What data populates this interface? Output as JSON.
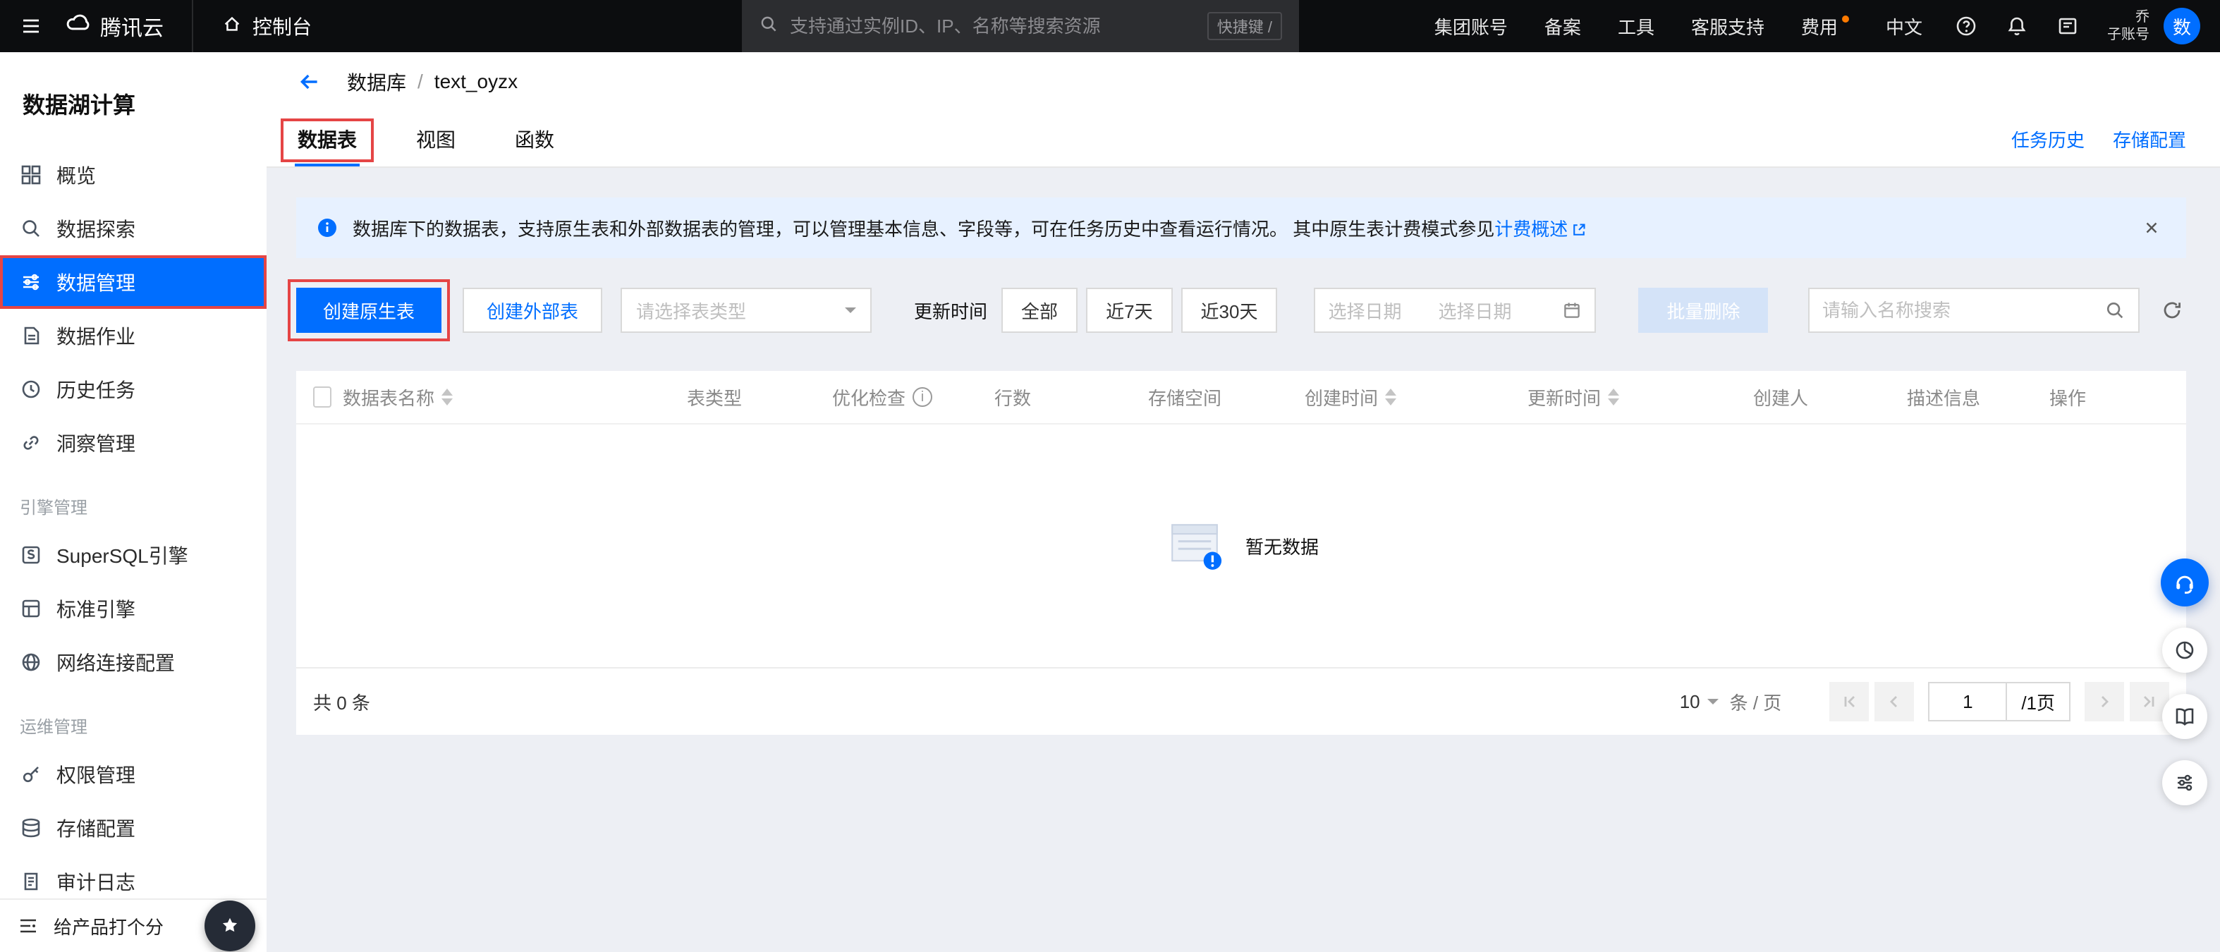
{
  "colors": {
    "accent": "#006eff",
    "annotation": "#e54545",
    "topbar_bg": "#0c0d0f",
    "banner_bg": "#e7f1ff"
  },
  "topbar": {
    "brand": "腾讯云",
    "console": "控制台",
    "search": {
      "placeholder": "支持通过实例ID、IP、名称等搜索资源",
      "shortcut": "快捷键 /"
    },
    "links": [
      "集团账号",
      "备案",
      "工具",
      "客服支持",
      "费用",
      "中文"
    ],
    "account": {
      "line1": "乔",
      "line2": "子账号",
      "avatar": "数"
    }
  },
  "sidebar": {
    "title": "数据湖计算",
    "items": [
      {
        "label": "概览"
      },
      {
        "label": "数据探索"
      },
      {
        "label": "数据管理"
      },
      {
        "label": "数据作业"
      },
      {
        "label": "历史任务"
      },
      {
        "label": "洞察管理"
      },
      {
        "label": "SuperSQL引擎"
      },
      {
        "label": "标准引擎"
      },
      {
        "label": "网络连接配置"
      },
      {
        "label": "权限管理"
      },
      {
        "label": "存储配置"
      },
      {
        "label": "审计日志"
      }
    ],
    "headings": {
      "engine": "引擎管理",
      "ops": "运维管理"
    },
    "footer": "给产品打个分"
  },
  "page": {
    "breadcrumb": {
      "parent": "数据库",
      "separator": "/",
      "current": "text_oyzx"
    },
    "tabs": [
      "数据表",
      "视图",
      "函数"
    ],
    "links": [
      "任务历史",
      "存储配置"
    ],
    "banner": {
      "text": "数据库下的数据表，支持原生表和外部数据表的管理，可以管理基本信息、字段等，可在任务历史中查看运行情况。 其中原生表计费模式参见",
      "link": "计费概述"
    },
    "toolbar": {
      "create_native": "创建原生表",
      "create_external": "创建外部表",
      "type_placeholder": "请选择表类型",
      "update_time": "更新时间",
      "ranges": [
        "全部",
        "近7天",
        "近30天"
      ],
      "date_start": "选择日期",
      "date_end": "选择日期",
      "batch_delete": "批量删除",
      "search_placeholder": "请输入名称搜索"
    },
    "table": {
      "columns": [
        "数据表名称",
        "表类型",
        "优化检查",
        "行数",
        "存储空间",
        "创建时间",
        "更新时间",
        "创建人",
        "描述信息",
        "操作"
      ],
      "empty": "暂无数据"
    },
    "pagination": {
      "total": "共 0 条",
      "page_size": "10",
      "unit": "条 / 页",
      "current": "1",
      "pages": "/1页"
    }
  }
}
